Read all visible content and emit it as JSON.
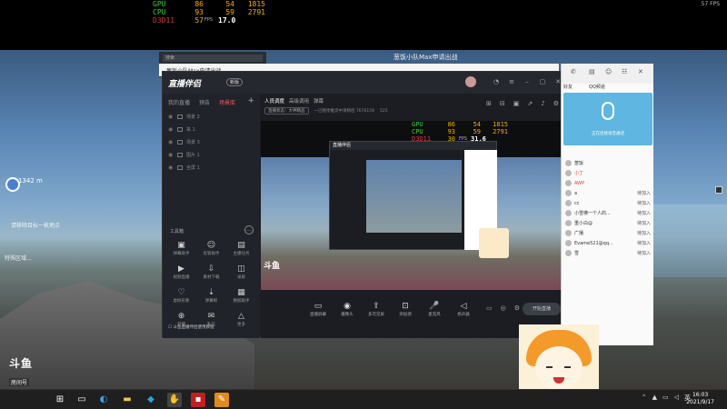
{
  "osd": {
    "gpu_label": "GPU",
    "gpu_temp": "86",
    "gpu_pct": "54",
    "gpu_clock": "1815",
    "cpu_label": "CPU",
    "cpu_temp": "93",
    "cpu_pct": "59",
    "cpu_clock": "2791",
    "d3d_label": "D3D11",
    "fps_value": "57",
    "fps_unit": "FPS",
    "frametime": "17.0",
    "fps_corner": "57 FPS"
  },
  "window_title": "葱饭小队Max申请出战",
  "back_window": {
    "label": "葱饭小队Max申请出战"
  },
  "app": {
    "logo": "直播伴侣",
    "badge": "新版",
    "sidebar_tabs": [
      "我的直播",
      "预告",
      "场景库"
    ],
    "scenes": [
      "场景 2",
      "来 1",
      "场景 3",
      "图片 1",
      "全屏 1"
    ],
    "tools_header": "工具箱",
    "tools": [
      {
        "icon": "▣",
        "label": "弹幕助手"
      },
      {
        "icon": "☺",
        "label": "房管助手"
      },
      {
        "icon": "▤",
        "label": "主播任务"
      },
      {
        "icon": "▶",
        "label": "视频直播"
      },
      {
        "icon": "⇩",
        "label": "素材下载"
      },
      {
        "icon": "◫",
        "label": "录屏"
      },
      {
        "icon": "♡",
        "label": "虚拟形象"
      },
      {
        "icon": "⇣",
        "label": "弹幕姬"
      },
      {
        "icon": "▦",
        "label": "数据助手"
      },
      {
        "icon": "⊕",
        "label": "开播"
      },
      {
        "icon": "✉",
        "label": "私信"
      },
      {
        "icon": "△",
        "label": "更多"
      }
    ],
    "side_footer": "☐ 斗鱼直播伴侣使用教程",
    "main_tabs": [
      "人员调度",
      "高级调用",
      "弹幕"
    ],
    "status_pill": "直播状态：大神精品",
    "status_text": "一已暂停推流中请稍后     7676159",
    "status_count": "525",
    "preview_osd": {
      "gpu_label": "GPU",
      "gpu_temp": "86",
      "gpu_pct": "54",
      "gpu_clock": "1815",
      "cpu_label": "CPU",
      "cpu_temp": "93",
      "cpu_pct": "59",
      "cpu_clock": "2791",
      "d3d_label": "D3D11",
      "fps_value": "30",
      "fps_unit": "FPS",
      "frametime": "31.6"
    },
    "controls": [
      {
        "icon": "▭",
        "label": "直播屏幕"
      },
      {
        "icon": "◉",
        "label": "摄像头"
      },
      {
        "icon": "⇪",
        "label": "多可见屏"
      },
      {
        "icon": "⊡",
        "label": "添加源"
      },
      {
        "icon": "🎤",
        "label": "麦克风"
      },
      {
        "icon": "◁",
        "label": "扬声器"
      }
    ],
    "go_live": "开始直播"
  },
  "chat": {
    "tabs": [
      "好友",
      "QQ频道"
    ],
    "voice_text": "正在连接语音通话",
    "contacts": [
      {
        "name": "葱饭",
        "status": "",
        "red": false
      },
      {
        "name": "小丁",
        "status": "",
        "red": true
      },
      {
        "name": "AWP",
        "status": "",
        "red": true
      },
      {
        "name": "a",
        "status": "待加入",
        "red": false
      },
      {
        "name": "cc",
        "status": "待加入",
        "red": false
      },
      {
        "name": "小雪佛一个人的...",
        "status": "待加入",
        "red": false
      },
      {
        "name": "重小白@",
        "status": "待加入",
        "red": false
      },
      {
        "name": "广播",
        "status": "待加入",
        "red": false
      },
      {
        "name": "Evame521@qq...",
        "status": "待加入",
        "red": false
      },
      {
        "name": "雪",
        "status": "待加入",
        "red": false
      }
    ]
  },
  "game": {
    "waypoint_distance": "1342 m",
    "tip": "请移除目标一枚地点",
    "tip2": "特殊区域..."
  },
  "douyu": {
    "brand": "斗鱼",
    "room_label": "房间号",
    "room_number": "7676159"
  },
  "taskbar": {
    "time": "16:03",
    "date": "2021/9/17"
  }
}
